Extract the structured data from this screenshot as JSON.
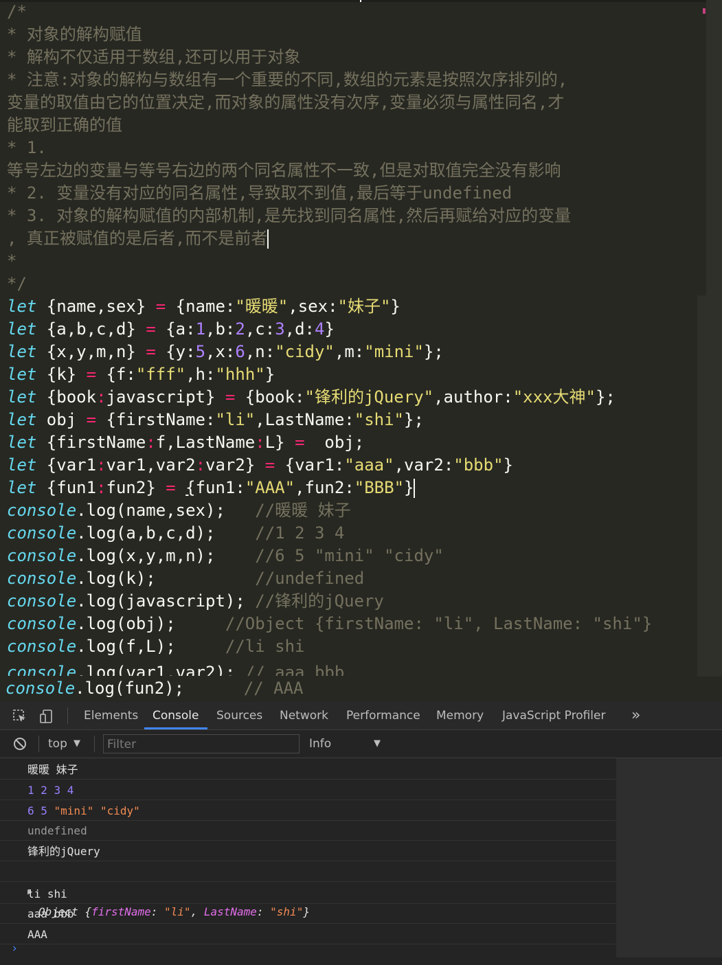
{
  "editor": {
    "comment_lines": [
      "/*",
      "* 对象的解构赋值",
      "* 解构不仅适用于数组,还可以用于对象",
      "* 注意:对象的解构与数组有一个重要的不同,数组的元素是按照次序排列的,",
      "变量的取值由它的位置决定,而对象的属性没有次序,变量必须与属性同名,才",
      "能取到正确的值",
      "* 1.",
      "等号左边的变量与等号右边的两个同名属性不一致,但是对取值完全没有影响",
      "* 2. 变量没有对应的同名属性,导致取不到值,最后等于undefined",
      "* 3. 对象的解构赋值的内部机制,是先找到同名属性,然后再赋给对应的变量",
      ", 真正被赋值的是后者,而不是前者",
      "*",
      "*/"
    ],
    "code": {
      "l1": {
        "kw": "let",
        "a": " {name,sex} ",
        "op": "=",
        "b": " {name:",
        "s1": "\"暖暖\"",
        "c": ",sex:",
        "s2": "\"妹子\"",
        "d": "}"
      },
      "l2": {
        "kw": "let",
        "a": " {a,b,c,d} ",
        "op": "=",
        "b": " {a:",
        "n1": "1",
        "c": ",b:",
        "n2": "2",
        "d": ",c:",
        "n3": "3",
        "e": ",d:",
        "n4": "4",
        "f": "}"
      },
      "l3": {
        "kw": "let",
        "a": " {x,y,m,n} ",
        "op": "=",
        "b": " {y:",
        "n1": "5",
        "c": ",x:",
        "n2": "6",
        "d": ",n:",
        "s1": "\"cidy\"",
        "e": ",m:",
        "s2": "\"mini\"",
        "f": "};"
      },
      "l4": {
        "kw": "let",
        "a": " {k} ",
        "op": "=",
        "b": " {f:",
        "s1": "\"fff\"",
        "c": ",h:",
        "s2": "\"hhh\"",
        "d": "}"
      },
      "l5": {
        "kw": "let",
        "a": " {book",
        "op1": ":",
        "b": "javascript} ",
        "op": "=",
        "c": " {book:",
        "s1": "\"锋利的jQuery\"",
        "d": ",author:",
        "s2": "\"xxx大神\"",
        "e": "};"
      },
      "l6": {
        "kw": "let",
        "a": " obj ",
        "op": "=",
        "b": " {firstName:",
        "s1": "\"li\"",
        "c": ",LastName:",
        "s2": "\"shi\"",
        "d": "};"
      },
      "l7": {
        "kw": "let",
        "a": " {firstName",
        "op1": ":",
        "b": "f,LastName",
        "op2": ":",
        "c": "L} ",
        "op": "=",
        "d": "  obj;"
      },
      "l8": {
        "kw": "let",
        "a": " {var1",
        "op1": ":",
        "b": "var1,var2",
        "op2": ":",
        "c": "var2} ",
        "op": "=",
        "d": " {var1:",
        "s1": "\"aaa\"",
        "e": ",var2:",
        "s2": "\"bbb\"",
        "f": "}"
      },
      "l9": {
        "kw": "let",
        "a": " {fun1",
        "op1": ":",
        "b": "fun2} ",
        "op": "=",
        "c": " ",
        "u": "{",
        "d": "fun1:",
        "s1": "\"AAA\"",
        "e": ",fun2:",
        "s2": "\"BBB\"",
        "f": "}"
      }
    },
    "console_lines": [
      {
        "obj": "console",
        "call": ".log(name,sex);   ",
        "cm": "//暖暖 妹子"
      },
      {
        "obj": "console",
        "call": ".log(a,b,c,d);    ",
        "cm": "//1 2 3 4"
      },
      {
        "obj": "console",
        "call": ".log(x,y,m,n);    ",
        "cm": "//6 5 \"mini\" \"cidy\""
      },
      {
        "obj": "console",
        "call": ".log(k);          ",
        "cm": "//undefined"
      },
      {
        "obj": "console",
        "call": ".log(javascript); ",
        "cm": "//锋利的jQuery"
      },
      {
        "obj": "console",
        "call": ".log(obj);     ",
        "cm": "//Object {firstName: \"li\", LastName: \"shi\"}"
      },
      {
        "obj": "console",
        "call": ".log(f,L);     ",
        "cm": "//li shi"
      },
      {
        "obj": "console",
        "call": ".log(var1,var2); ",
        "cm": "// aaa bbb"
      },
      {
        "obj": "console",
        "call": ".log(fun2);      ",
        "cm": "// AAA"
      }
    ]
  },
  "devtools": {
    "tabs": [
      "Elements",
      "Console",
      "Sources",
      "Network",
      "Performance",
      "Memory",
      "JavaScript Profiler"
    ],
    "active_tab": "Console",
    "more": "»",
    "context": "top",
    "filter_placeholder": "Filter",
    "level": "Info",
    "logs": {
      "r1": "暖暖 妹子",
      "r2": "1 2 3 4",
      "r3a": "6 5 ",
      "r3b": "\"mini\"",
      "r3c": " ",
      "r3d": "\"cidy\"",
      "r4": "undefined",
      "r5": "锋利的jQuery",
      "r6": {
        "arrow": "▶",
        "label": "Object {",
        "k1": "firstName",
        "c1": ": ",
        "v1": "\"li\"",
        "sep": ", ",
        "k2": "LastName",
        "c2": ": ",
        "v2": "\"shi\"",
        "end": "}"
      },
      "r7": "li shi",
      "r8": "aaa bbb",
      "r9": "AAA"
    },
    "prompt": "›",
    "colors": {
      "accent": "#4285f4",
      "number": "#9980ff",
      "string": "#f28b54",
      "key": "#e36eec"
    }
  }
}
